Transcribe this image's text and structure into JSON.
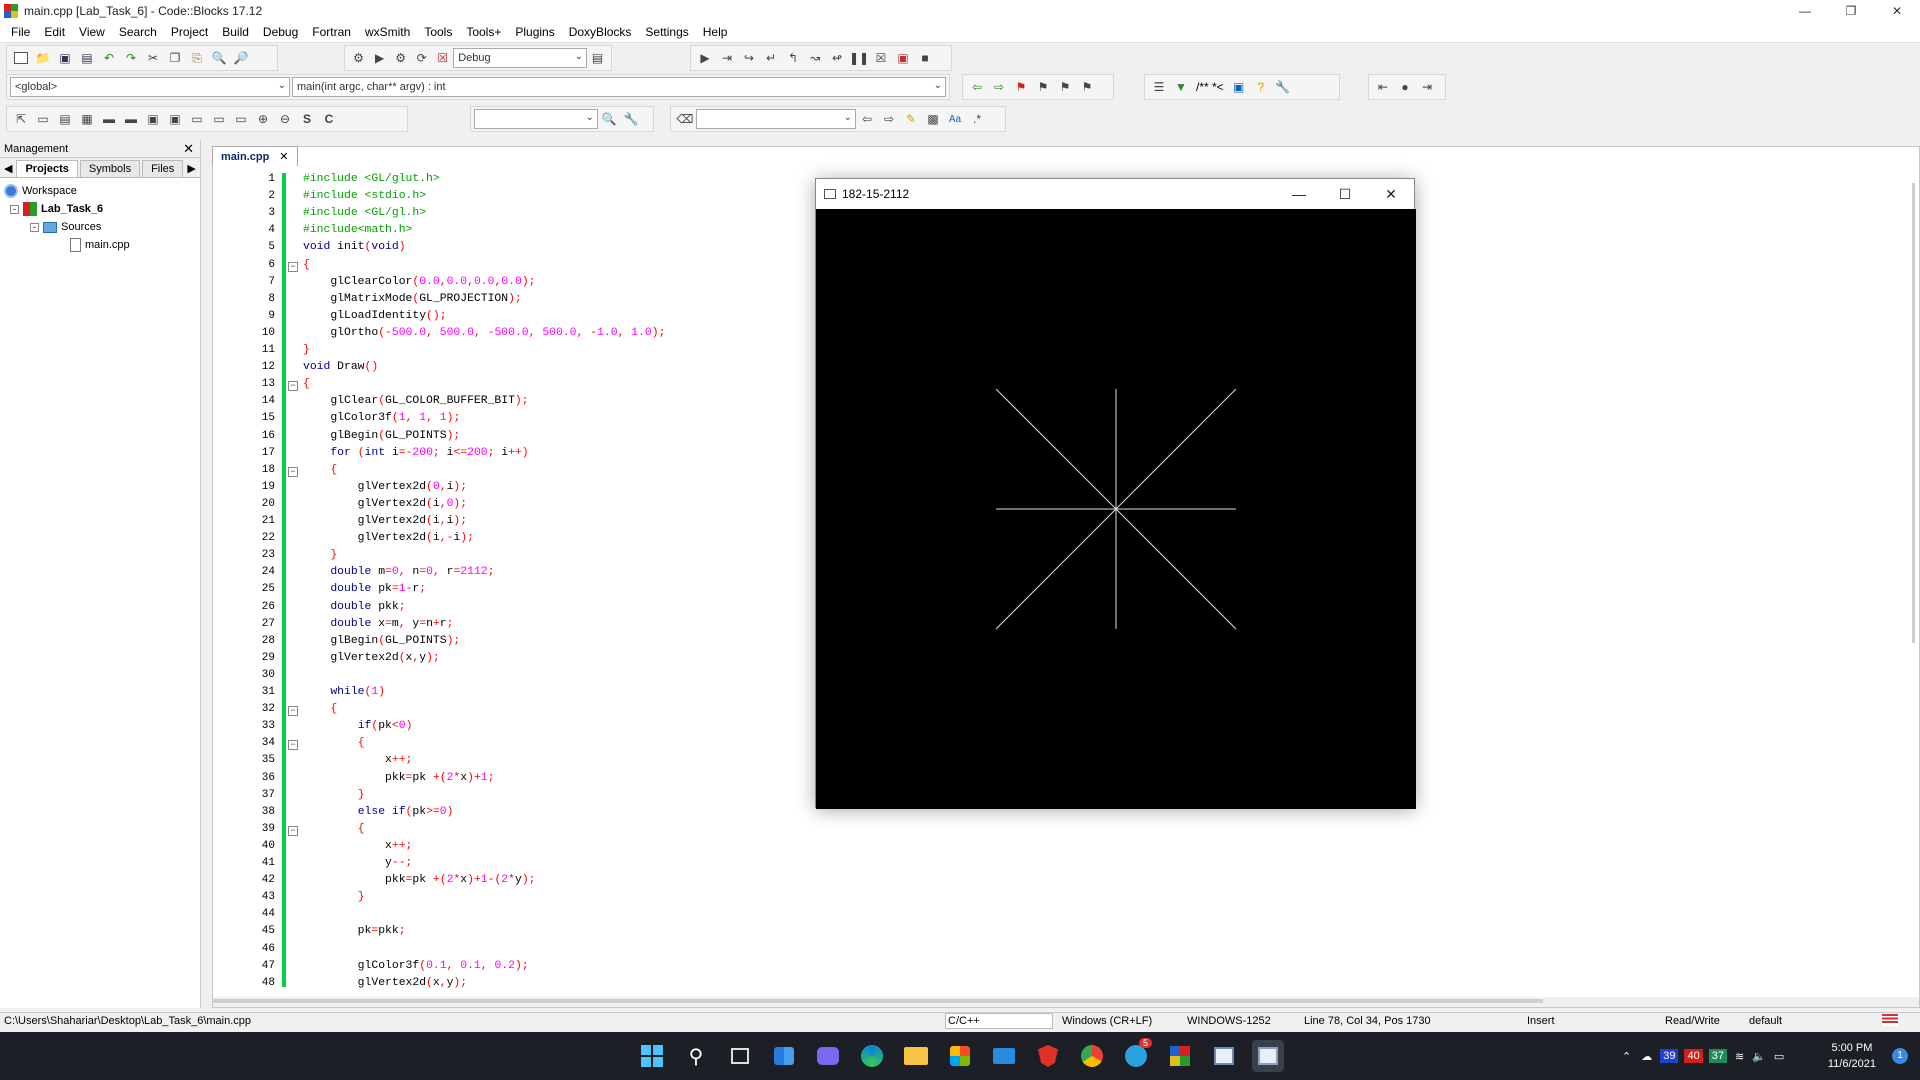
{
  "window": {
    "title": "main.cpp [Lab_Task_6] - Code::Blocks 17.12",
    "min_icon": "minimize-icon",
    "max_icon": "restore-icon",
    "close_icon": "close-icon"
  },
  "menu": [
    "File",
    "Edit",
    "View",
    "Search",
    "Project",
    "Build",
    "Debug",
    "Fortran",
    "wxSmith",
    "Tools",
    "Tools+",
    "Plugins",
    "DoxyBlocks",
    "Settings",
    "Help"
  ],
  "toolbar": {
    "build_target": "Debug",
    "scope_combo": "<global>",
    "function_combo": "main(int argc, char** argv) : int",
    "doxy_comment": "/** *<",
    "search_combo": "",
    "replace_combo": ""
  },
  "management": {
    "title": "Management",
    "tabs": [
      "Projects",
      "Symbols",
      "Files"
    ],
    "tree": {
      "workspace": "Workspace",
      "project": "Lab_Task_6",
      "folder": "Sources",
      "file": "main.cpp"
    }
  },
  "editor": {
    "tab_label": "main.cpp",
    "lines": [
      {
        "n": "1",
        "t": "pp",
        "c": "#include <GL/glut.h>"
      },
      {
        "n": "2",
        "t": "pp",
        "c": "#include <stdio.h>"
      },
      {
        "n": "3",
        "t": "pp",
        "c": "#include <GL/gl.h>"
      },
      {
        "n": "4",
        "t": "pp",
        "c": "#include<math.h>"
      },
      {
        "n": "5",
        "t": "code",
        "c": "void init(void)"
      },
      {
        "n": "6",
        "t": "code",
        "c": "{"
      },
      {
        "n": "7",
        "t": "code",
        "c": "    glClearColor(0.0,0.0,0.0,0.0);"
      },
      {
        "n": "8",
        "t": "code",
        "c": "    glMatrixMode(GL_PROJECTION);"
      },
      {
        "n": "9",
        "t": "code",
        "c": "    glLoadIdentity();"
      },
      {
        "n": "10",
        "t": "code",
        "c": "    glOrtho(-500.0, 500.0, -500.0, 500.0, -1.0, 1.0);"
      },
      {
        "n": "11",
        "t": "code",
        "c": "}"
      },
      {
        "n": "12",
        "t": "code",
        "c": "void Draw()"
      },
      {
        "n": "13",
        "t": "code",
        "c": "{"
      },
      {
        "n": "14",
        "t": "code",
        "c": "    glClear(GL_COLOR_BUFFER_BIT);"
      },
      {
        "n": "15",
        "t": "code",
        "c": "    glColor3f(1, 1, 1);"
      },
      {
        "n": "16",
        "t": "code",
        "c": "    glBegin(GL_POINTS);"
      },
      {
        "n": "17",
        "t": "code",
        "c": "    for (int i=-200; i<=200; i++)"
      },
      {
        "n": "18",
        "t": "code",
        "c": "    {"
      },
      {
        "n": "19",
        "t": "code",
        "c": "        glVertex2d(0,i);"
      },
      {
        "n": "20",
        "t": "code",
        "c": "        glVertex2d(i,0);"
      },
      {
        "n": "21",
        "t": "code",
        "c": "        glVertex2d(i,i);"
      },
      {
        "n": "22",
        "t": "code",
        "c": "        glVertex2d(i,-i);"
      },
      {
        "n": "23",
        "t": "code",
        "c": "    }"
      },
      {
        "n": "24",
        "t": "code",
        "c": "    double m=0, n=0, r=2112;"
      },
      {
        "n": "25",
        "t": "code",
        "c": "    double pk=1-r;"
      },
      {
        "n": "26",
        "t": "code",
        "c": "    double pkk;"
      },
      {
        "n": "27",
        "t": "code",
        "c": "    double x=m, y=n+r;"
      },
      {
        "n": "28",
        "t": "code",
        "c": "    glBegin(GL_POINTS);"
      },
      {
        "n": "29",
        "t": "code",
        "c": "    glVertex2d(x,y);"
      },
      {
        "n": "30",
        "t": "code",
        "c": ""
      },
      {
        "n": "31",
        "t": "code",
        "c": "    while(1)"
      },
      {
        "n": "32",
        "t": "code",
        "c": "    {"
      },
      {
        "n": "33",
        "t": "code",
        "c": "        if(pk<0)"
      },
      {
        "n": "34",
        "t": "code",
        "c": "        {"
      },
      {
        "n": "35",
        "t": "code",
        "c": "            x++;"
      },
      {
        "n": "36",
        "t": "code",
        "c": "            pkk=pk +(2*x)+1;"
      },
      {
        "n": "37",
        "t": "code",
        "c": "        }"
      },
      {
        "n": "38",
        "t": "code",
        "c": "        else if(pk>=0)"
      },
      {
        "n": "39",
        "t": "code",
        "c": "        {"
      },
      {
        "n": "40",
        "t": "code",
        "c": "            x++;"
      },
      {
        "n": "41",
        "t": "code",
        "c": "            y--;"
      },
      {
        "n": "42",
        "t": "code",
        "c": "            pkk=pk +(2*x)+1-(2*y);"
      },
      {
        "n": "43",
        "t": "code",
        "c": "        }"
      },
      {
        "n": "44",
        "t": "code",
        "c": ""
      },
      {
        "n": "45",
        "t": "code",
        "c": "        pk=pkk;"
      },
      {
        "n": "46",
        "t": "code",
        "c": ""
      },
      {
        "n": "47",
        "t": "code",
        "c": "        glColor3f(0.1, 0.1, 0.2);"
      },
      {
        "n": "48",
        "t": "code",
        "c": "        glVertex2d(x,y);"
      }
    ],
    "fold_lines": [
      "6",
      "13",
      "18",
      "32",
      "34",
      "39"
    ]
  },
  "glwindow": {
    "title": "182-15-2112",
    "min_icon": "minimize-icon",
    "max_icon": "maximize-icon",
    "close_icon": "close-icon"
  },
  "status": {
    "path": "C:\\Users\\Shahariar\\Desktop\\Lab_Task_6\\main.cpp",
    "language": "C/C++",
    "eol": "Windows (CR+LF)",
    "encoding": "WINDOWS-1252",
    "position": "Line 78, Col 34, Pos 1730",
    "mode": "Insert",
    "access": "Read/Write",
    "profile": "default"
  },
  "taskbar": {
    "icons": [
      "windows-start-icon",
      "search-icon",
      "task-view-icon",
      "widgets-icon",
      "chat-icon",
      "edge-icon",
      "file-explorer-icon",
      "store-icon",
      "mail-icon",
      "brave-icon",
      "chrome-icon",
      "telegram-icon",
      "codeblocks-icon",
      "notepad-icon",
      "opengl-window-icon"
    ],
    "telegram_badge": "5",
    "tray_counts": [
      "39",
      "40",
      "37"
    ],
    "time": "5:00 PM",
    "date": "11/6/2021",
    "notification_count": "1"
  }
}
